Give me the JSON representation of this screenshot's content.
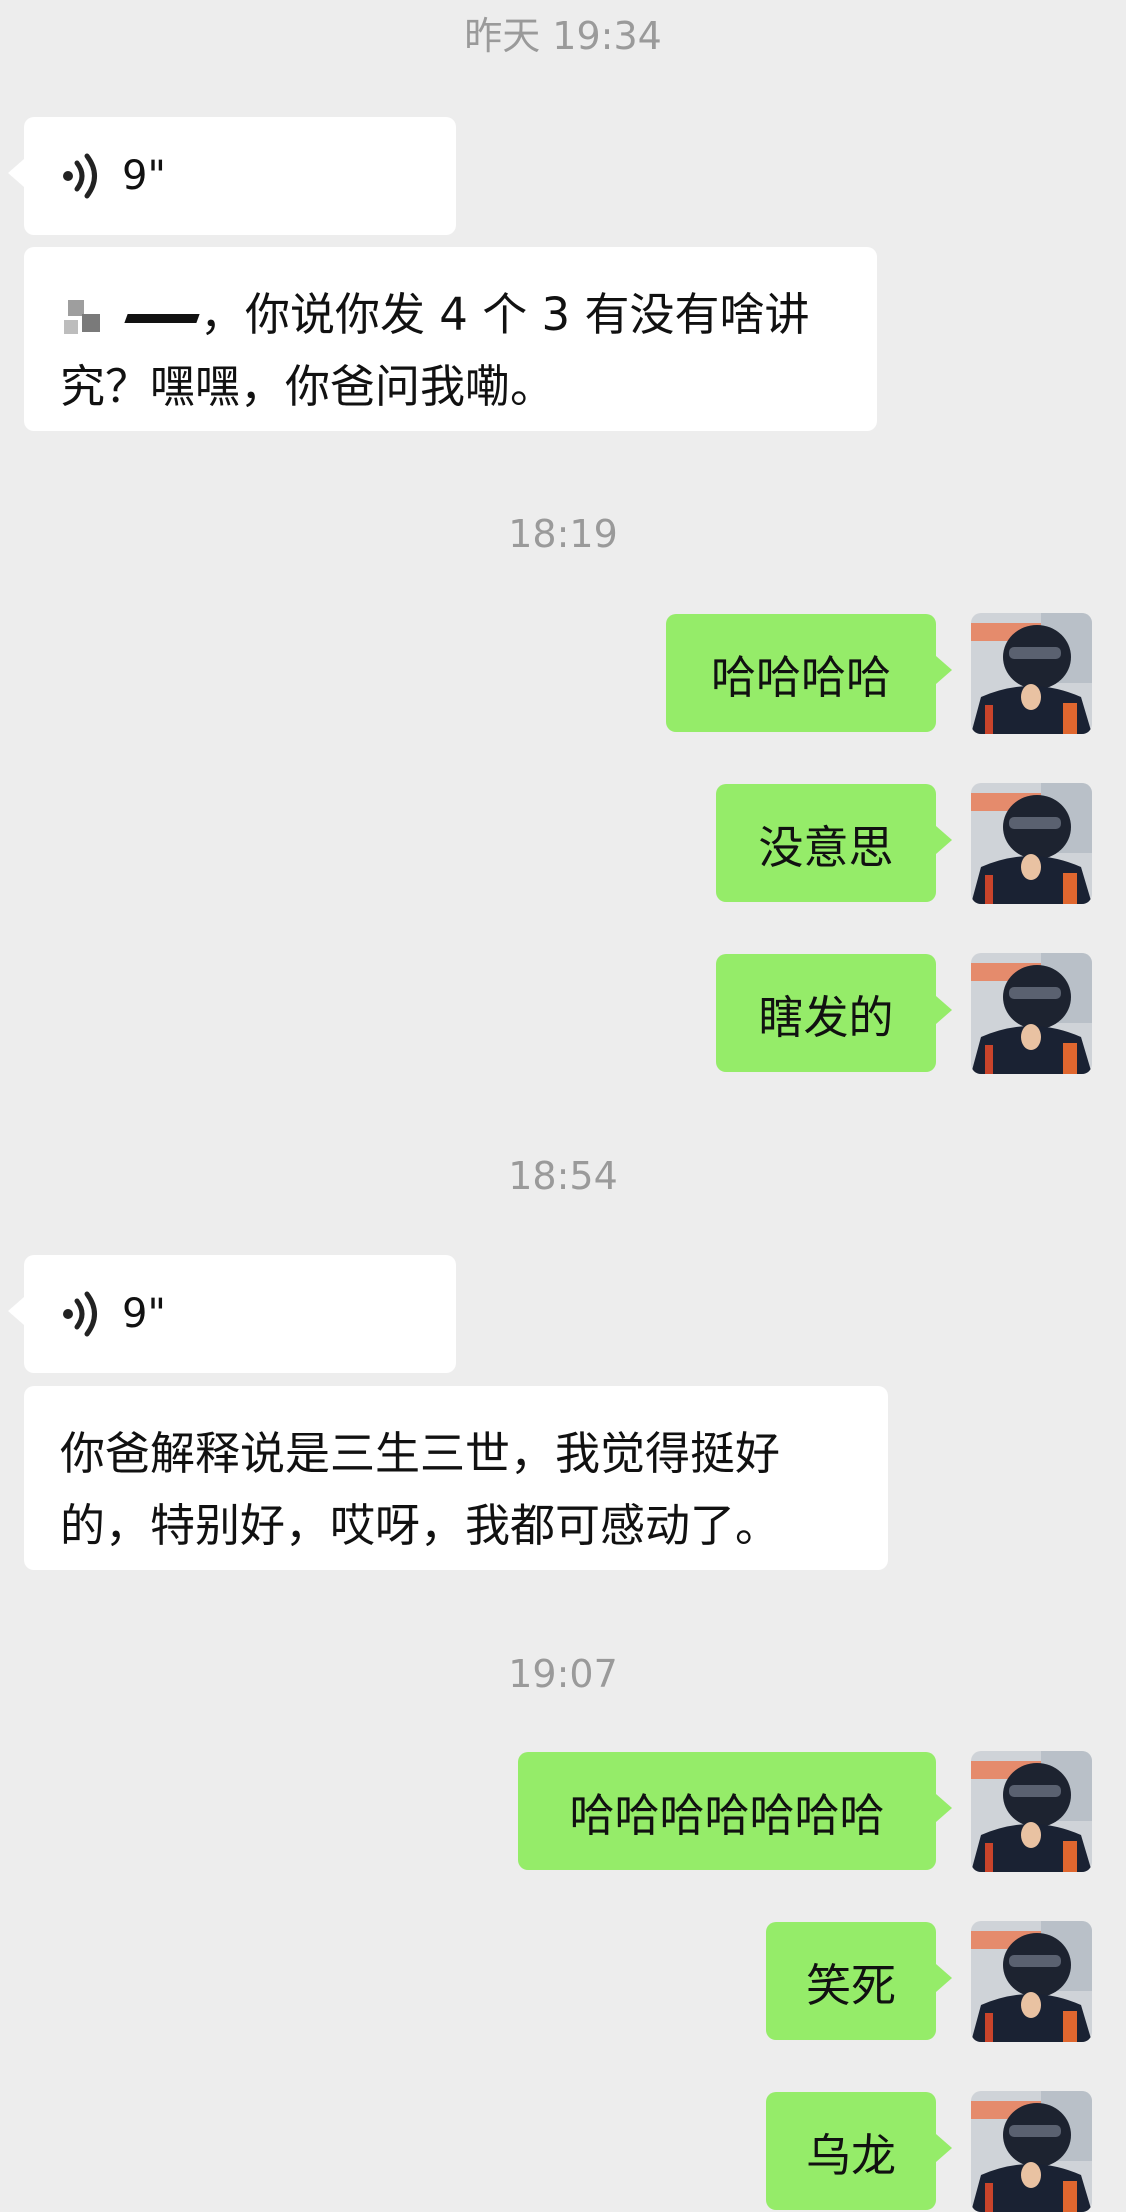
{
  "timestamps": [
    "昨天 19:34",
    "18:19",
    "18:54",
    "19:07"
  ],
  "messages": [
    {
      "side": "left",
      "kind": "voice",
      "icon": "voice-wave-icon",
      "duration": "9\""
    },
    {
      "side": "left",
      "kind": "text",
      "redacted_prefix": true,
      "text": "，你说你发 4 个 3 有没有啥讲究？嘿嘿，你爸问我嘞。"
    },
    {
      "side": "right",
      "kind": "text",
      "text": "哈哈哈哈"
    },
    {
      "side": "right",
      "kind": "text",
      "text": "没意思"
    },
    {
      "side": "right",
      "kind": "text",
      "text": "瞎发的"
    },
    {
      "side": "left",
      "kind": "voice",
      "icon": "voice-wave-icon",
      "duration": "9\""
    },
    {
      "side": "left",
      "kind": "text",
      "text": "你爸解释说是三生三世，我觉得挺好的，特别好，哎呀，我都可感动了。"
    },
    {
      "side": "right",
      "kind": "text",
      "text": "哈哈哈哈哈哈哈"
    },
    {
      "side": "right",
      "kind": "text",
      "text": "笑死"
    },
    {
      "side": "right",
      "kind": "text",
      "text": "乌龙"
    }
  ],
  "colors": {
    "background": "#ededed",
    "incoming_bubble": "#ffffff",
    "outgoing_bubble": "#95ec69",
    "timestamp": "#9a9a9a"
  },
  "avatar_icon": "racing-helmet-avatar"
}
